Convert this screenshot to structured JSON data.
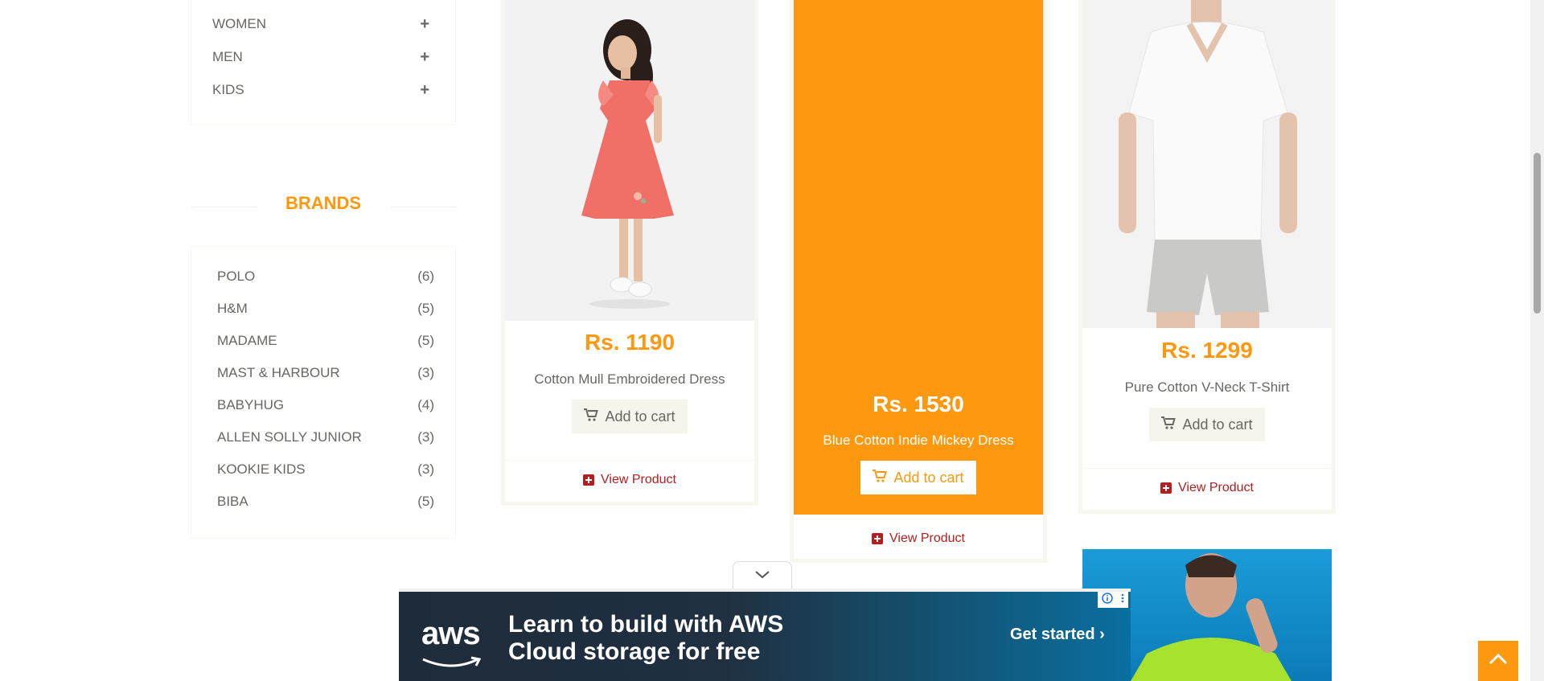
{
  "categories": [
    {
      "label": "WOMEN"
    },
    {
      "label": "MEN"
    },
    {
      "label": "KIDS"
    }
  ],
  "brands_title": "BRANDS",
  "brands": [
    {
      "name": "POLO",
      "count": "(6)"
    },
    {
      "name": "H&M",
      "count": "(5)"
    },
    {
      "name": "MADAME",
      "count": "(5)"
    },
    {
      "name": "MAST & HARBOUR",
      "count": "(3)"
    },
    {
      "name": "BABYHUG",
      "count": "(4)"
    },
    {
      "name": "ALLEN SOLLY JUNIOR",
      "count": "(3)"
    },
    {
      "name": "KOOKIE KIDS",
      "count": "(3)"
    },
    {
      "name": "BIBA",
      "count": "(5)"
    }
  ],
  "products": [
    {
      "price": "Rs. 1190",
      "name": "Cotton Mull Embroidered Dress",
      "add_to_cart": "Add to cart",
      "view": "View Product"
    },
    {
      "price": "Rs. 1530",
      "name": "Blue Cotton Indie Mickey Dress",
      "add_to_cart": "Add to cart",
      "view": "View Product"
    },
    {
      "price": "Rs. 1299",
      "name": "Pure Cotton V-Neck T-Shirt",
      "add_to_cart": "Add to cart",
      "view": "View Product"
    }
  ],
  "ad": {
    "brand": "aws",
    "headline_1": "Learn to build with AWS",
    "headline_2": "Cloud storage for free",
    "cta": "Get started ›"
  },
  "icons": {
    "plus": "plus-icon",
    "cart": "shopping-cart-icon",
    "view": "plus-square-icon",
    "scroll_up": "chevron-up-icon",
    "collapse": "chevron-down-icon"
  },
  "colors": {
    "accent": "#FE980F",
    "link": "#B41E1E",
    "text": "#696763"
  }
}
